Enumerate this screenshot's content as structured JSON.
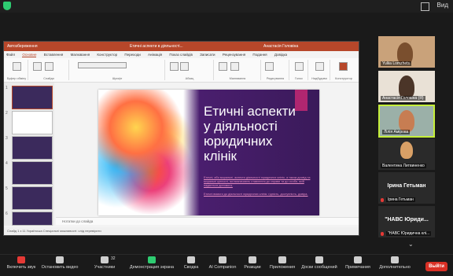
{
  "top": {
    "view_label": "Вид"
  },
  "ppt": {
    "title_left": "Автозбереження",
    "title_center": "Етичні аспекти в діяльності...",
    "title_right": "Анастасія Головіна",
    "menu": [
      "Файл",
      "Основне",
      "Вставлення",
      "Малювання",
      "Конструктор",
      "Переходи",
      "Анімація",
      "Показ слайдів",
      "Записати",
      "Рецензування",
      "Подання",
      "Довідка"
    ],
    "ribbon_groups": [
      "Буфер обміну",
      "Слайди",
      "Шрифт",
      "Абзац",
      "Малювання",
      "Редагування",
      "Голос",
      "Надбудови",
      "Конструктор"
    ],
    "slide": {
      "title": "Етичні аспекти у діяльності юридичних клінік",
      "sub1": "Етичні, або моральні, аспекти діяльності юридичних клінік, а також досвід та моральні цінності, які визначають ставлення до справи та до особи, якій надається допомога.",
      "sub2": "Етичні вимоги до діяльності юридичних клінік: гідність, доступність, довіра."
    },
    "notes": "Нотатки до слайда",
    "status": "Слайд 1 з 11   Українська   Спеціальні можливості: слід перевірити"
  },
  "participants": [
    {
      "name": "Yuliia Lomzhets"
    },
    {
      "name": "Анастасія Головіна (Я)"
    },
    {
      "name": "Лілія Амірова"
    },
    {
      "name": "Валентина Литвиненко"
    },
    {
      "name": "Ірина Гетьман",
      "big": "Ірина Гетьман"
    },
    {
      "name": "\"НАВС Юридична клі...",
      "big": "\"НАВС Юриди..."
    }
  ],
  "toolbar": {
    "mute": "Включить звук",
    "video": "Остановить видео",
    "participants": "Участники",
    "participants_count": "32",
    "share": "Демонстрация экрана",
    "summary": "Сводка",
    "ai": "AI Companion",
    "reactions": "Реакции",
    "apps": "Приложения",
    "whiteboard": "Доски сообщений",
    "notes": "Примечания",
    "more": "Дополнительно",
    "exit": "Выйти"
  }
}
